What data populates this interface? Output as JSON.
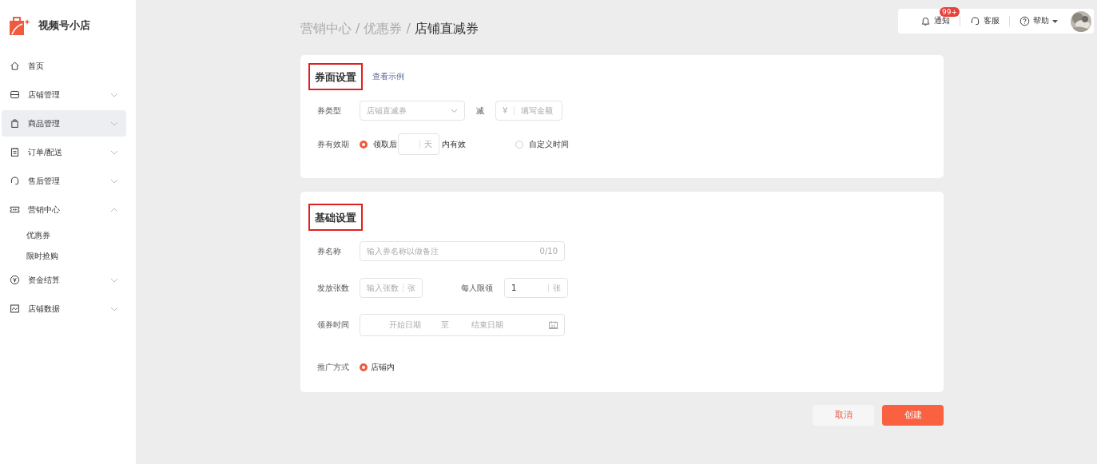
{
  "app": {
    "name": "视频号小店"
  },
  "sidebar": {
    "items": [
      {
        "label": "首页",
        "kind": "link",
        "selected": false
      },
      {
        "label": "店铺管理",
        "kind": "group",
        "selected": false,
        "expanded": false
      },
      {
        "label": "商品管理",
        "kind": "group",
        "selected": true,
        "expanded": false
      },
      {
        "label": "订单/配送",
        "kind": "group",
        "selected": false,
        "expanded": false
      },
      {
        "label": "售后管理",
        "kind": "group",
        "selected": false,
        "expanded": false
      },
      {
        "label": "营销中心",
        "kind": "group",
        "selected": false,
        "expanded": true,
        "children": [
          {
            "label": "优惠券",
            "selected": false
          },
          {
            "label": "限时抢购",
            "selected": false
          }
        ]
      },
      {
        "label": "资金结算",
        "kind": "group",
        "selected": false,
        "expanded": false
      },
      {
        "label": "店铺数据",
        "kind": "group",
        "selected": false,
        "expanded": false
      }
    ]
  },
  "toolbar": {
    "notifications": {
      "label": "通知",
      "badge": "99+"
    },
    "service": {
      "label": "客服"
    },
    "help": {
      "label": "帮助"
    }
  },
  "breadcrumb": {
    "items": [
      "营销中心",
      "优惠券",
      "店铺直减券"
    ],
    "separator": "/"
  },
  "coupon_settings": {
    "title": "券面设置",
    "highlighted": true,
    "link": "查看示例",
    "type": {
      "label": "券类型",
      "placeholder": "店铺直减券"
    },
    "discount": {
      "label": "减",
      "prefix": "¥",
      "placeholder": "填写金额"
    },
    "validity": {
      "label": "券有效期",
      "options": [
        {
          "label": "领取后",
          "selected": true,
          "unit": "天",
          "after": "内有效"
        },
        {
          "label": "自定义时间",
          "selected": false
        }
      ]
    }
  },
  "basic_settings": {
    "title": "基础设置",
    "highlighted": true,
    "name": {
      "label": "券名称",
      "placeholder": "输入券名称以做备注",
      "counter": "0/10"
    },
    "quantity": {
      "label": "发放张数",
      "placeholder": "输入张数",
      "unit": "张"
    },
    "limit": {
      "label": "每人限领",
      "value": "1",
      "unit": "张"
    },
    "time": {
      "label": "领券时间",
      "start": "开始日期",
      "separator": "至",
      "end": "结束日期"
    },
    "promotion": {
      "label": "推广方式",
      "options": [
        {
          "label": "店铺内",
          "selected": true
        }
      ]
    }
  },
  "buttons": {
    "cancel": "取消",
    "create": "创建"
  }
}
